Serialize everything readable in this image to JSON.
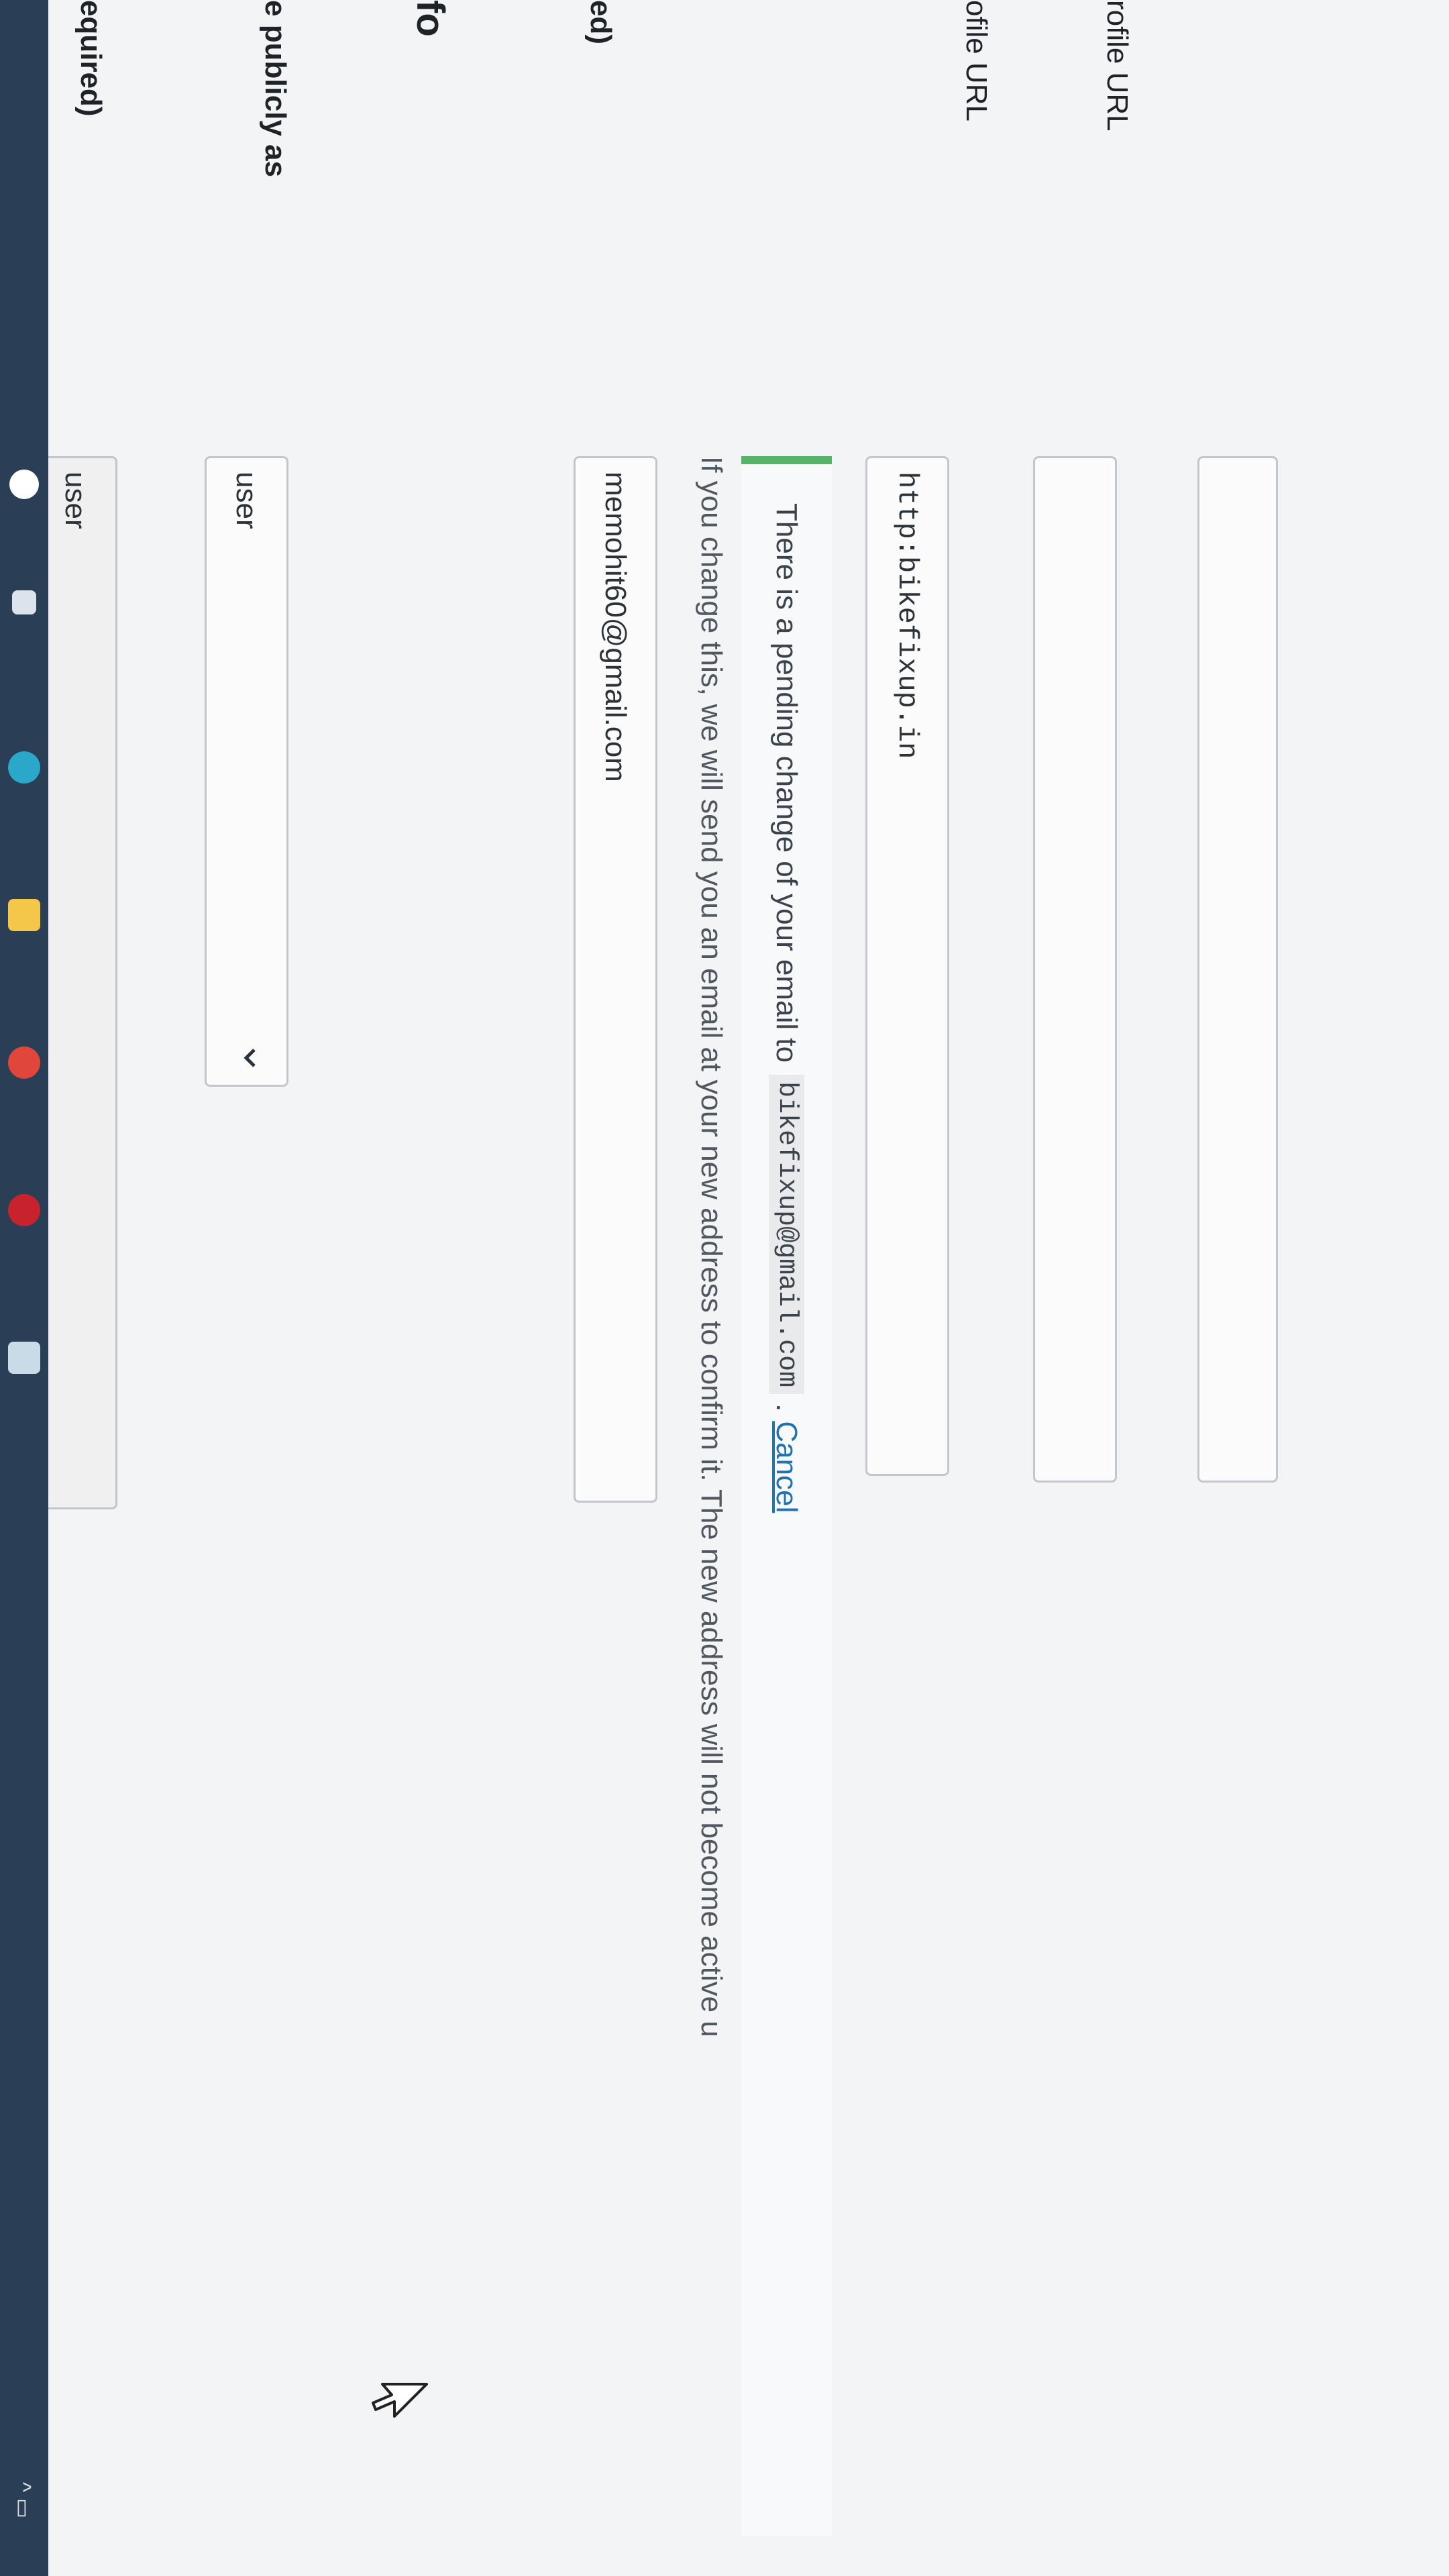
{
  "labels": {
    "username_required": "equired)",
    "display_publicly": "e publicly as",
    "section_info": "fo",
    "email_required": "ed)",
    "profile_url_1": "ofile URL",
    "profile_url_2": "rofile URL"
  },
  "fields": {
    "username": "user",
    "display_name": "user",
    "email": "memohit60@gmail.com",
    "website": "http:bikefixup.in",
    "profile_url_1": "",
    "profile_url_2": ""
  },
  "email_description": "If you change this, we will send you an email at your new address to confirm it. The new address will not become active u",
  "pending_notice": {
    "text": "There is a pending change of your email to",
    "email": "bikefixup@gmail.com",
    "separator": ".",
    "cancel": "Cancel"
  },
  "colors": {
    "notice_border": "#58b36a",
    "link": "#2271b1",
    "taskbar": "#2a3f56"
  },
  "taskbar": {
    "icons": [
      "search-icon",
      "task-view-icon",
      "edge-icon",
      "file-explorer-icon",
      "chrome-icon",
      "opera-icon",
      "app-icon"
    ],
    "tray": "^ ▭"
  }
}
